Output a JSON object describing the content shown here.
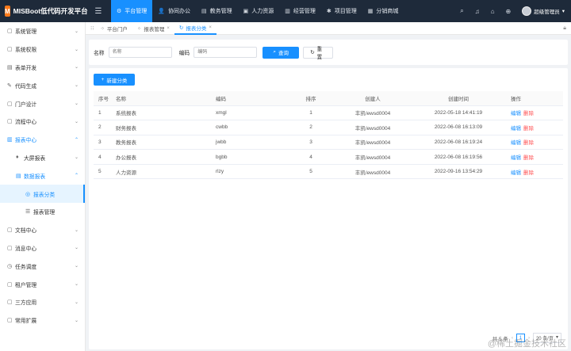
{
  "brand": {
    "logo_letter": "M",
    "title": "MISBoot低代码开发平台"
  },
  "topnav": [
    {
      "label": "平台管理",
      "icon": "⚙",
      "active": true
    },
    {
      "label": "协同办公",
      "icon": "👤",
      "active": false
    },
    {
      "label": "教务管理",
      "icon": "▤",
      "active": false
    },
    {
      "label": "人力资源",
      "icon": "▣",
      "active": false
    },
    {
      "label": "经营管理",
      "icon": "▥",
      "active": false
    },
    {
      "label": "项目管理",
      "icon": "✱",
      "active": false
    },
    {
      "label": "分销商城",
      "icon": "▦",
      "active": false
    }
  ],
  "topright": {
    "user": "超级管理员",
    "icons": [
      "search-icon",
      "bell-icon",
      "lock-icon",
      "globe-icon"
    ]
  },
  "sidebar": [
    {
      "label": "系统管理",
      "icon": "▢",
      "level": 0
    },
    {
      "label": "系统权限",
      "icon": "▢",
      "level": 0
    },
    {
      "label": "表单开发",
      "icon": "▤",
      "level": 0
    },
    {
      "label": "代码生成",
      "icon": "✎",
      "level": 0
    },
    {
      "label": "门户设计",
      "icon": "▢",
      "level": 0
    },
    {
      "label": "流程中心",
      "icon": "▢",
      "level": 0
    },
    {
      "label": "报表中心",
      "icon": "▥",
      "level": 0,
      "open": true
    },
    {
      "label": "大屏报表",
      "icon": "♦",
      "level": 1
    },
    {
      "label": "数据报表",
      "icon": "▤",
      "level": 1,
      "open": true
    },
    {
      "label": "报表分类",
      "icon": "◎",
      "level": 2,
      "selected": true
    },
    {
      "label": "报表管理",
      "icon": "☰",
      "level": 2
    },
    {
      "label": "文档中心",
      "icon": "▢",
      "level": 0
    },
    {
      "label": "消息中心",
      "icon": "▢",
      "level": 0
    },
    {
      "label": "任务调度",
      "icon": "◷",
      "level": 0
    },
    {
      "label": "租户管理",
      "icon": "▢",
      "level": 0
    },
    {
      "label": "三方应用",
      "icon": "▢",
      "level": 0
    },
    {
      "label": "常用扩展",
      "icon": "▢",
      "level": 0
    }
  ],
  "tabs": [
    {
      "label": "平台门户",
      "closable": false,
      "active": false
    },
    {
      "label": "报表管理",
      "closable": true,
      "active": false
    },
    {
      "label": "报表分类",
      "closable": true,
      "active": true
    }
  ],
  "search": {
    "name_label": "名称",
    "name_placeholder": "名称",
    "code_label": "编码",
    "code_placeholder": "编码",
    "query_label": "查询",
    "reset_label": "重置"
  },
  "new_button": "新建分类",
  "table": {
    "headers": [
      "序号",
      "名称",
      "编码",
      "排序",
      "创建人",
      "创建时间",
      "操作"
    ],
    "rows": [
      [
        "1",
        "系统报表",
        "xmgl",
        "1",
        "丰凯/ewsd0004",
        "2022-05-18 14:41:19"
      ],
      [
        "2",
        "财务报表",
        "cwbb",
        "2",
        "丰凯/ewsd0004",
        "2022-06-08 16:13:09"
      ],
      [
        "3",
        "教务报表",
        "jwbb",
        "3",
        "丰凯/ewsd0004",
        "2022-06-08 16:19:24"
      ],
      [
        "4",
        "办公报表",
        "bgbb",
        "4",
        "丰凯/ewsd0004",
        "2022-06-08 16:19:56"
      ],
      [
        "5",
        "人力资源",
        "rlzy",
        "5",
        "丰凯/ewsd0004",
        "2022-09-16 13:54:29"
      ]
    ],
    "edit_label": "编辑",
    "delete_label": "删除"
  },
  "pager": {
    "total": "共 5 条",
    "page": "1",
    "size": "20 条/页"
  },
  "watermark": "@稀土掘金技术社区"
}
